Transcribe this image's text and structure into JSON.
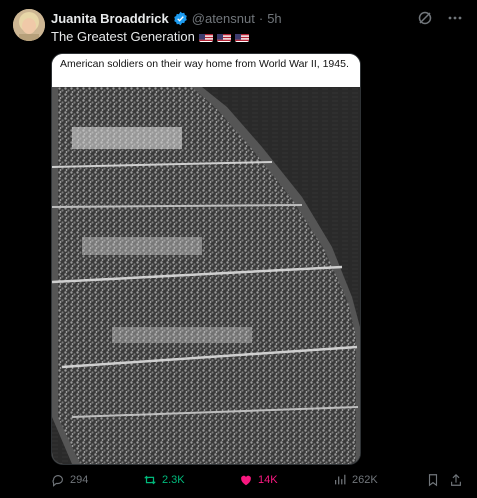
{
  "author": {
    "name": "Juanita Broaddrick",
    "handle": "@atensnut",
    "separator": "·",
    "time": "5h"
  },
  "post": {
    "text": "The Greatest Generation",
    "flags": [
      "us-flag",
      "us-flag",
      "us-flag"
    ]
  },
  "media": {
    "caption": "American soldiers on their way home from World War II, 1945."
  },
  "actions": {
    "replies": "294",
    "reposts": "2.3K",
    "likes": "14K",
    "views": "262K"
  },
  "colors": {
    "repost": "#00ba7c",
    "like": "#f91880",
    "muted": "#71767b",
    "verified": "#1d9bf0"
  }
}
